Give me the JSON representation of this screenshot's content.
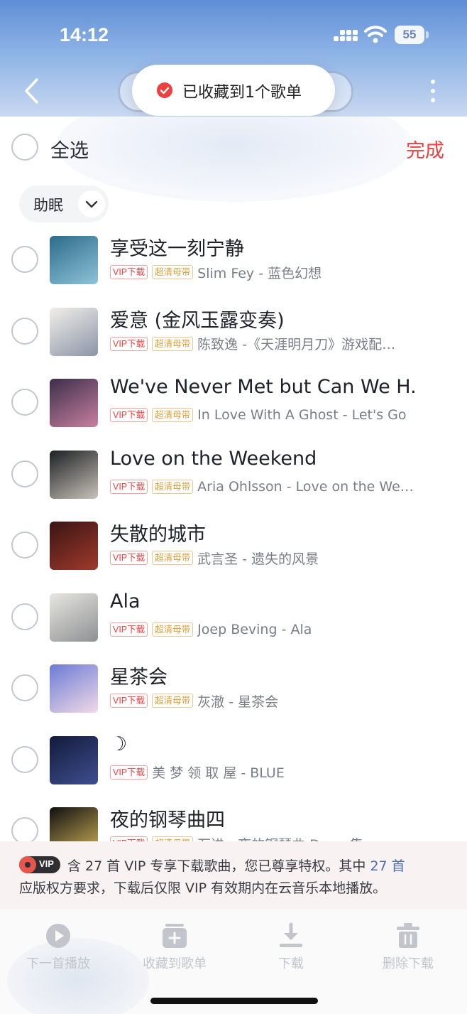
{
  "status_bar": {
    "time": "14:12",
    "battery": "55"
  },
  "toast": {
    "text": "已收藏到1个歌单"
  },
  "edit_bar": {
    "select_all_label": "全选",
    "done_label": "完成"
  },
  "filter": {
    "label": "助眠"
  },
  "songs": [
    {
      "title": "享受这一刻宁静",
      "vip_tag": "VIP下载",
      "quality_tag": "超清母带",
      "subtitle": "Slim Fey - 蓝色幻想",
      "cover_colors": [
        "#2b6b8a",
        "#8fc3d8"
      ]
    },
    {
      "title": "爱意 (金风玉露变奏)",
      "vip_tag": "VIP下载",
      "quality_tag": "超清母带",
      "subtitle": "陈致逸 -《天涯明月刀》游戏配…",
      "cover_colors": [
        "#f2efe9",
        "#8b94a8"
      ]
    },
    {
      "title": "We've Never Met but Can We H...",
      "vip_tag": "VIP下载",
      "quality_tag": "超清母带",
      "subtitle": "In Love With A Ghost - Let's Go",
      "cover_colors": [
        "#3b2f4a",
        "#c97fa0"
      ]
    },
    {
      "title": "Love on the Weekend",
      "vip_tag": "VIP下载",
      "quality_tag": "超清母带",
      "subtitle": "Aria Ohlsson - Love on the We…",
      "cover_colors": [
        "#1c1f24",
        "#c9c3b8"
      ]
    },
    {
      "title": "失散的城市",
      "vip_tag": "VIP下载",
      "quality_tag": "超清母带",
      "subtitle": "武言圣 - 遗失的风景",
      "cover_colors": [
        "#3a1414",
        "#a03a2c"
      ]
    },
    {
      "title": "Ala",
      "vip_tag": "VIP下载",
      "quality_tag": "超清母带",
      "subtitle": "Joep Beving - Ala",
      "cover_colors": [
        "#e7e6e1",
        "#8e9092"
      ]
    },
    {
      "title": "星茶会",
      "vip_tag": "VIP下载",
      "quality_tag": "超清母带",
      "subtitle": "灰澈 - 星茶会",
      "cover_colors": [
        "#6b7bd6",
        "#f1d9e6"
      ]
    },
    {
      "title": "☽",
      "vip_tag": "VIP下载",
      "quality_tag": "",
      "subtitle": "美 梦 领 取 屋 - BLUE",
      "cover_colors": [
        "#131a3a",
        "#3e4f8f"
      ]
    },
    {
      "title": "夜的钢琴曲四",
      "vip_tag": "VIP下载",
      "quality_tag": "超清母带",
      "subtitle": "石进 - 夜的钢琴曲 Demo集",
      "cover_colors": [
        "#0f0f10",
        "#d2b35a"
      ]
    }
  ],
  "notice": {
    "badge": "VIP",
    "line1_pre": "含 27 首 VIP 专享下载歌曲，您已尊享特权。其中",
    "line1_link": "27 首",
    "line2": "应版权方要求，下载后仅限 VIP 有效期内在云音乐本地播放。"
  },
  "toolbar": {
    "items": [
      {
        "label": "下一首播放",
        "icon": "play-next-icon"
      },
      {
        "label": "收藏到歌单",
        "icon": "add-to-playlist-icon"
      },
      {
        "label": "下载",
        "icon": "download-icon"
      },
      {
        "label": "删除下载",
        "icon": "trash-icon"
      }
    ]
  },
  "colors": {
    "accent_red": "#ec4141",
    "link_blue": "#4b6fb0",
    "header_blue": "#5f8ed6"
  }
}
